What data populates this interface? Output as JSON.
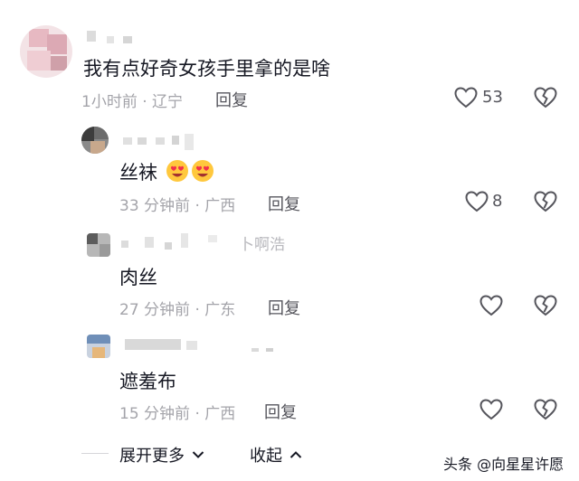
{
  "comments": [
    {
      "text": "我有点好奇女孩手里拿的是啥",
      "time_location": "1小时前 · 辽宁",
      "reply_label": "回复",
      "likes": "53"
    },
    {
      "text": "丝袜",
      "time_location": "33 分钟前 · 广西",
      "reply_label": "回复",
      "likes": "8",
      "emoji": [
        "smiling-face-with-heart-eyes",
        "smiling-face-with-heart-eyes"
      ]
    },
    {
      "tag": "卜啊浩",
      "text": "肉丝",
      "time_location": "27 分钟前 · 广东",
      "reply_label": "回复"
    },
    {
      "text": "遮羞布",
      "time_location": "15 分钟前 · 广西",
      "reply_label": "回复"
    }
  ],
  "footer": {
    "expand_label": "展开更多",
    "collapse_label": "收起"
  },
  "watermark": "头条 @向星星许愿",
  "colors": {
    "text": "#161823",
    "meta": "#a4a4aa",
    "action": "#55555c"
  }
}
